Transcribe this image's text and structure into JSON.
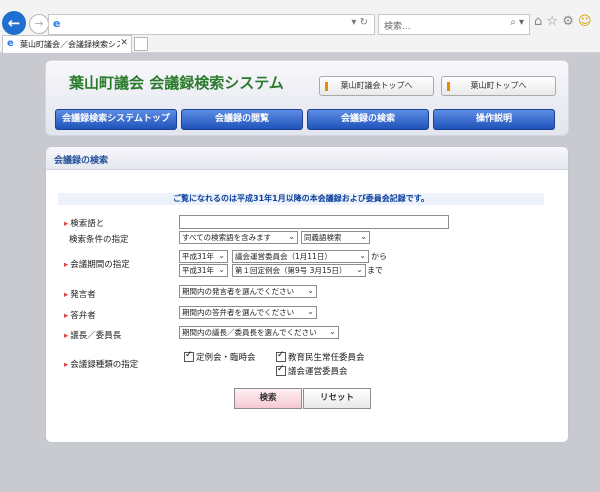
{
  "browser": {
    "tab_title": "葉山町議会／会議録検索シス...",
    "search_placeholder": "検索..."
  },
  "header": {
    "title": "葉山町議会 会議録検索システム",
    "top_links": [
      "葉山町議会トップへ",
      "葉山町トップへ"
    ],
    "menu": [
      "会議録検索システムトップ",
      "会議録の閲覧",
      "会議録の検索",
      "操作説明"
    ]
  },
  "section": {
    "title": "会議録の検索",
    "notice": "ご覧になれるのは平成31年1月以降の本会議録および委員会記録です。"
  },
  "form": {
    "labels": [
      "検索語と",
      "検索条件の指定",
      "会議期間の指定",
      "発言者",
      "答弁者",
      "議長／委員長",
      "会議録種類の指定"
    ],
    "search_mode": "すべての検索語を含みます",
    "search_type": "同義語検索",
    "period": {
      "from_era": "平成31年",
      "from_meeting": "議会運営委員会（1月11日）",
      "from_suffix": "から",
      "to_era": "平成31年",
      "to_meeting": "第１回定例会（第9号 3月15日）",
      "to_suffix": "まで"
    },
    "speaker": "期間内の発言者を選んでください",
    "respondent": "期間内の答弁者を選んでください",
    "chair": "期間内の議長／委員長を選んでください",
    "meeting_types": [
      "定例会・臨時会",
      "教育民生常任委員会",
      "議会運営委員会"
    ]
  },
  "buttons": {
    "search": "検索",
    "reset": "リセット"
  }
}
